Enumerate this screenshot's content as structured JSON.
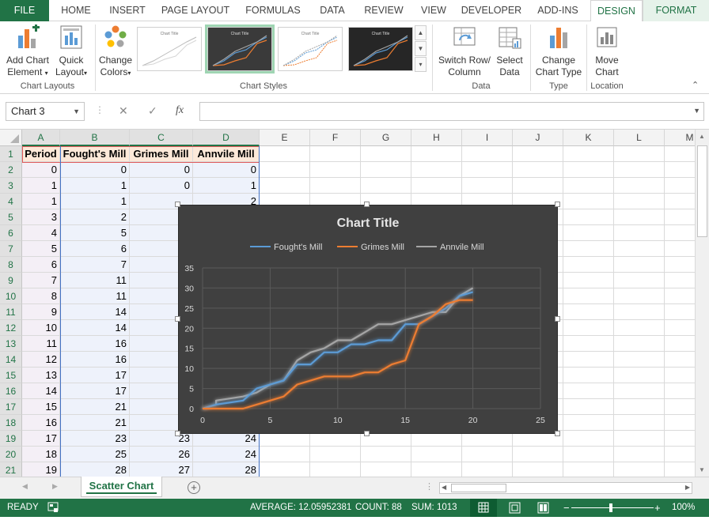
{
  "tabs": [
    "FILE",
    "HOME",
    "INSERT",
    "PAGE LAYOUT",
    "FORMULAS",
    "DATA",
    "REVIEW",
    "VIEW",
    "DEVELOPER",
    "ADD-INS",
    "DESIGN",
    "FORMAT"
  ],
  "active_tab": "DESIGN",
  "ribbon": {
    "add_chart_element": [
      "Add Chart",
      "Element"
    ],
    "quick_layout": [
      "Quick",
      "Layout"
    ],
    "chart_layouts_group": "Chart Layouts",
    "change_colors": [
      "Change",
      "Colors"
    ],
    "chart_styles_group": "Chart Styles",
    "thumb_title": "Chart Title",
    "switch_row_column": [
      "Switch Row/",
      "Column"
    ],
    "select_data": [
      "Select",
      "Data"
    ],
    "data_group": "Data",
    "change_chart_type": [
      "Change",
      "Chart Type"
    ],
    "type_group": "Type",
    "move_chart": [
      "Move",
      "Chart"
    ],
    "location_group": "Location"
  },
  "formula_bar": {
    "name_box": "Chart 3",
    "fx": "fx",
    "cancel": "✕",
    "enter": "✓",
    "value": ""
  },
  "columns": [
    "A",
    "B",
    "C",
    "D",
    "E",
    "F",
    "G",
    "H",
    "I",
    "J",
    "K",
    "L",
    "M"
  ],
  "headers": [
    "Period",
    "Fought's Mill",
    "Grimes Mill",
    "Annvile Mill"
  ],
  "row_numbers": [
    1,
    2,
    3,
    4,
    5,
    6,
    7,
    8,
    9,
    10,
    11,
    12,
    13,
    14,
    15,
    16,
    17,
    18,
    19,
    20,
    21
  ],
  "rows": [
    [
      "0",
      "0",
      "0",
      "0"
    ],
    [
      "1",
      "1",
      "0",
      "1"
    ],
    [
      "1",
      "1",
      "",
      "2"
    ],
    [
      "3",
      "2",
      "",
      ""
    ],
    [
      "4",
      "5",
      "",
      ""
    ],
    [
      "5",
      "6",
      "",
      ""
    ],
    [
      "6",
      "7",
      "",
      ""
    ],
    [
      "7",
      "11",
      "",
      ""
    ],
    [
      "8",
      "11",
      "",
      ""
    ],
    [
      "9",
      "14",
      "",
      ""
    ],
    [
      "10",
      "14",
      "",
      ""
    ],
    [
      "11",
      "16",
      "",
      ""
    ],
    [
      "12",
      "16",
      "",
      ""
    ],
    [
      "13",
      "17",
      "",
      ""
    ],
    [
      "14",
      "17",
      "",
      ""
    ],
    [
      "15",
      "21",
      "",
      ""
    ],
    [
      "16",
      "21",
      "",
      ""
    ],
    [
      "17",
      "23",
      "23",
      "24"
    ],
    [
      "18",
      "25",
      "26",
      "24"
    ],
    [
      "19",
      "28",
      "27",
      "28"
    ]
  ],
  "colors": {
    "excel_green": "#217346",
    "chart_bg": "#404040",
    "series_fought": "#5b9bd5",
    "series_grimes": "#ed7d31",
    "series_annvile": "#a5a5a5"
  },
  "chart_data": {
    "type": "line",
    "title": "Chart Title",
    "legend_position": "top",
    "grid": true,
    "xlim": [
      0,
      25
    ],
    "ylim": [
      0,
      35
    ],
    "x_ticks": [
      0,
      5,
      10,
      15,
      20,
      25
    ],
    "y_ticks": [
      0,
      5,
      10,
      15,
      20,
      25,
      30,
      35
    ],
    "series": [
      {
        "name": "Fought's Mill",
        "points": [
          [
            0,
            0
          ],
          [
            1,
            1
          ],
          [
            1,
            1
          ],
          [
            3,
            2
          ],
          [
            4,
            5
          ],
          [
            5,
            6
          ],
          [
            6,
            7
          ],
          [
            7,
            11
          ],
          [
            8,
            11
          ],
          [
            9,
            14
          ],
          [
            10,
            14
          ],
          [
            11,
            16
          ],
          [
            12,
            16
          ],
          [
            13,
            17
          ],
          [
            14,
            17
          ],
          [
            15,
            21
          ],
          [
            16,
            21
          ],
          [
            17,
            23
          ],
          [
            18,
            25
          ],
          [
            19,
            28
          ],
          [
            20,
            29
          ]
        ]
      },
      {
        "name": "Grimes Mill",
        "points": [
          [
            0,
            0
          ],
          [
            1,
            0
          ],
          [
            1,
            0
          ],
          [
            3,
            0
          ],
          [
            4,
            1
          ],
          [
            5,
            2
          ],
          [
            6,
            3
          ],
          [
            7,
            6
          ],
          [
            8,
            7
          ],
          [
            9,
            8
          ],
          [
            10,
            8
          ],
          [
            11,
            8
          ],
          [
            12,
            9
          ],
          [
            13,
            9
          ],
          [
            14,
            11
          ],
          [
            15,
            12
          ],
          [
            16,
            21
          ],
          [
            17,
            23
          ],
          [
            18,
            26
          ],
          [
            19,
            27
          ],
          [
            20,
            27
          ]
        ]
      },
      {
        "name": "Annvile Mill",
        "points": [
          [
            0,
            0
          ],
          [
            1,
            1
          ],
          [
            1,
            2
          ],
          [
            3,
            3
          ],
          [
            4,
            4
          ],
          [
            5,
            6
          ],
          [
            6,
            7
          ],
          [
            7,
            12
          ],
          [
            8,
            14
          ],
          [
            9,
            15
          ],
          [
            10,
            17
          ],
          [
            11,
            17
          ],
          [
            12,
            19
          ],
          [
            13,
            21
          ],
          [
            14,
            21
          ],
          [
            15,
            22
          ],
          [
            16,
            23
          ],
          [
            17,
            24
          ],
          [
            18,
            24
          ],
          [
            19,
            28
          ],
          [
            20,
            30
          ]
        ]
      }
    ]
  },
  "sheet": {
    "tab_name": "Scatter Chart",
    "add": "+"
  },
  "status": {
    "ready": "READY",
    "average": "AVERAGE: 12.05952381",
    "count": "COUNT: 88",
    "sum": "SUM: 1013",
    "zoom": "100%",
    "zoom_minus": "−",
    "zoom_plus": "+"
  }
}
